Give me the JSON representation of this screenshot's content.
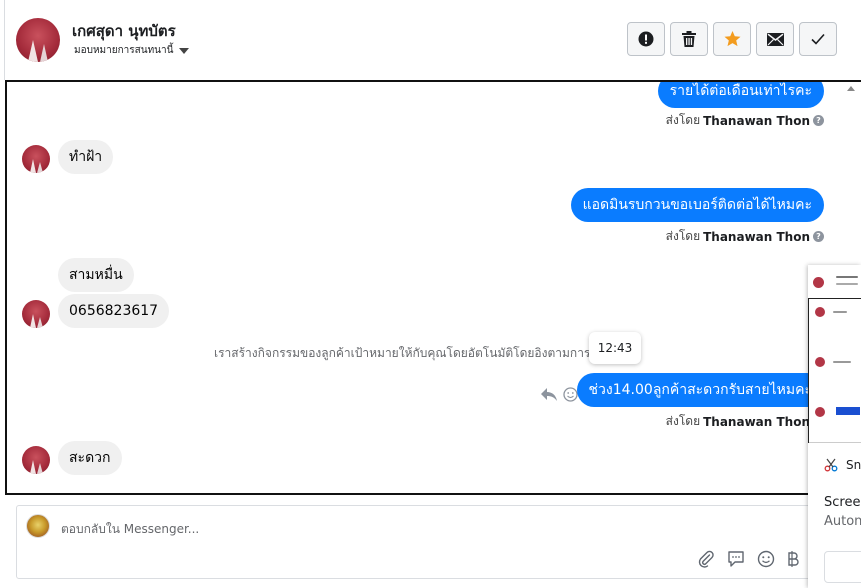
{
  "header": {
    "contact_name": "เกศสุดา นุทบัตร",
    "assign_label": "มอบหมายการสนทนานี้"
  },
  "toolbar": {
    "buttons": [
      "report",
      "delete",
      "star",
      "mail",
      "done"
    ],
    "star_color": "#f39c1f"
  },
  "messages": {
    "m1": "รายได้ต่อเดือนเท่าไรคะ",
    "m1_sender_prefix": "ส่งโดย",
    "m1_sender": "Thanawan Thon",
    "m2": "ทำฝ้า",
    "m3": "แอดมินรบกวนขอเบอร์ติดต่อได้ไหมคะ",
    "m3_sender_prefix": "ส่งโดย",
    "m3_sender": "Thanawan Thon",
    "m4": "สามหมื่น",
    "m5": "0656823617",
    "system": "เราสร้างกิจกรรมของลูกค้าเป้าหมายให้กับคุณโดยอัตโนมัติโดยอิงตามการส",
    "tooltip_time": "12:43",
    "m6": "ช่วง14.00ลูกค้าสะดวกรับสายไหมคะ",
    "m6_sender_prefix": "ส่งโดย",
    "m6_sender": "Thanawan Thon",
    "m7": "สะดวก"
  },
  "reply": {
    "placeholder": "ตอบกลับใน Messenger..."
  },
  "side_panel": {
    "app_label": "Sn",
    "line1": "Screer",
    "line2": "Auton"
  },
  "colors": {
    "outgoing_bubble": "#0a7cff",
    "incoming_bubble": "#f0f0f0"
  }
}
